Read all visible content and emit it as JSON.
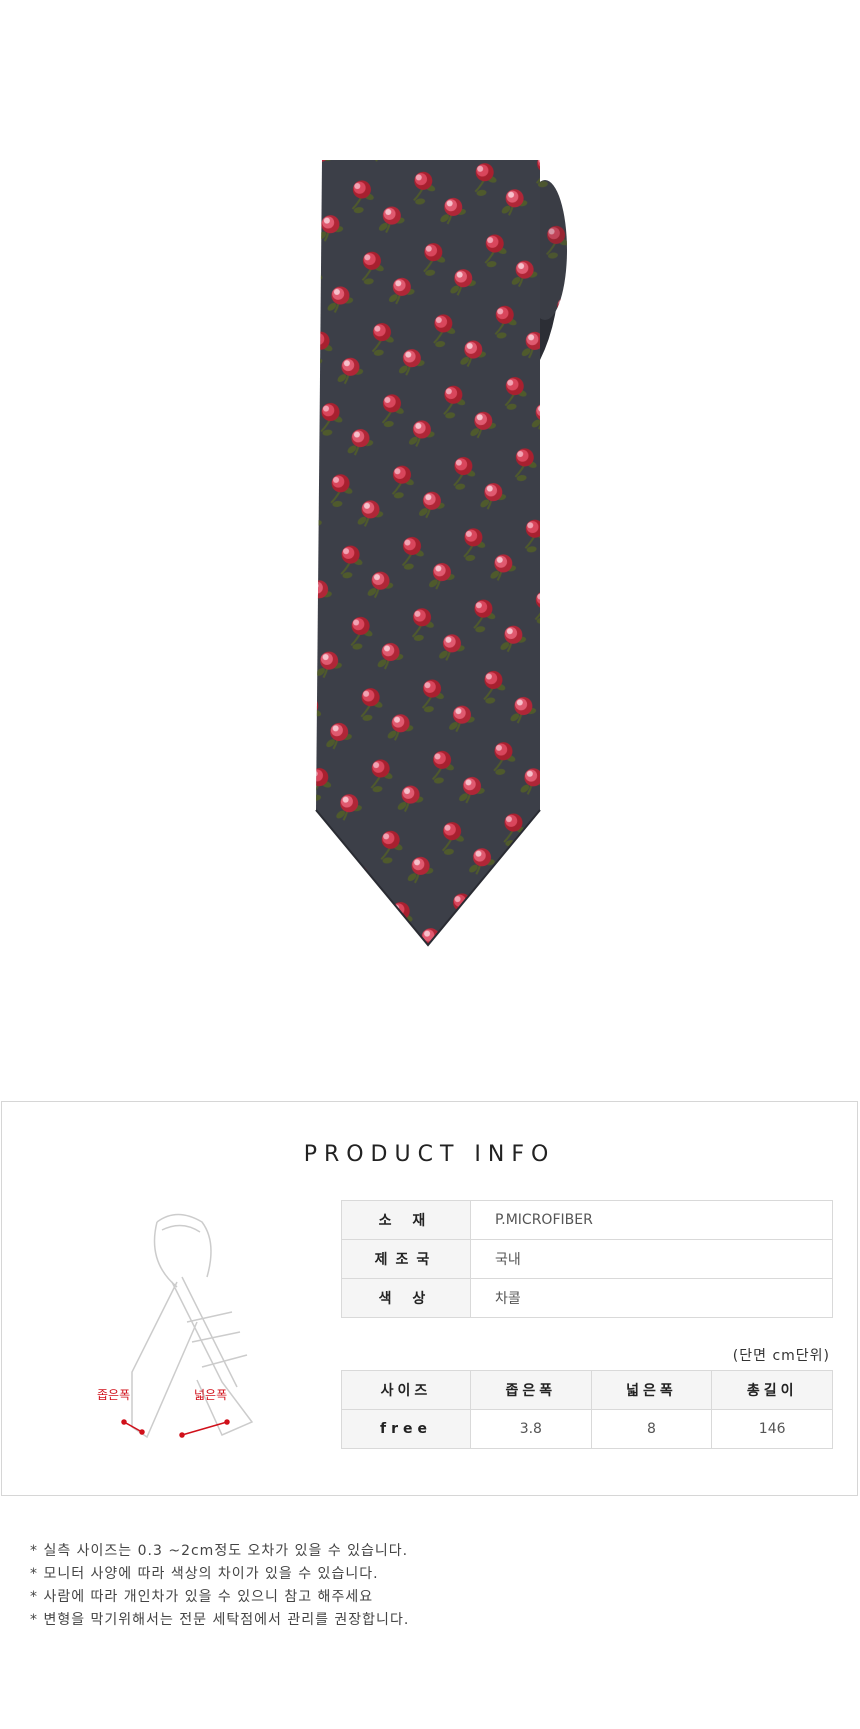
{
  "product_info": {
    "title": "PRODUCT INFO",
    "diagram": {
      "narrow_label": "좁은폭",
      "wide_label": "넓은폭",
      "label_color": "#d0101a"
    },
    "spec_rows": [
      {
        "key": "소 재",
        "value": "P.MICROFIBER"
      },
      {
        "key": "제조국",
        "value": "국내"
      },
      {
        "key": "색 상",
        "value": "차콜"
      }
    ],
    "unit_note": "(단면 cm단위)",
    "size_table": {
      "headers": [
        "사이즈",
        "좁은폭",
        "넓은폭",
        "총길이"
      ],
      "row": {
        "size": "free",
        "narrow": "3.8",
        "wide": "8",
        "length": "146"
      }
    }
  },
  "notes": [
    "* 실측 사이즈는 0.3 ~2cm정도 오차가 있을 수 있습니다.",
    "* 모니터 사양에 따라 색상의 차이가 있을 수 있습니다.",
    "* 사람에 따라 개인차가 있을 수 있으니 참고 해주세요",
    "* 변형을 막기위해서는 전문 세탁점에서 관리를 권장합니다."
  ],
  "colors": {
    "tie_fabric": "#3c3f48",
    "rose": "#c8344a",
    "rose_light": "#f2a3b3",
    "leaf": "#4f5a2c"
  }
}
